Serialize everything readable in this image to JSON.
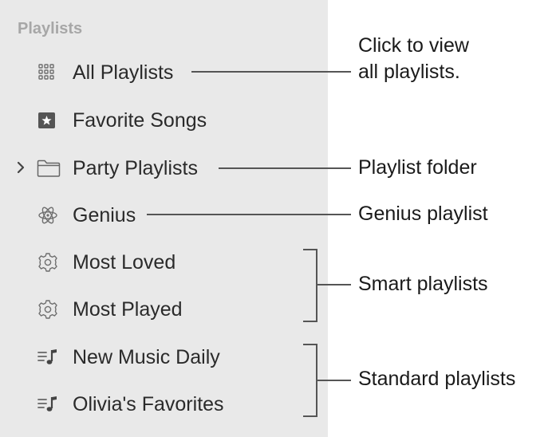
{
  "sidebar": {
    "section_title": "Playlists",
    "items": [
      {
        "label": "All Playlists",
        "icon": "grid-icon"
      },
      {
        "label": "Favorite Songs",
        "icon": "star-icon"
      },
      {
        "label": "Party Playlists",
        "icon": "folder-icon",
        "expandable": true
      },
      {
        "label": "Genius",
        "icon": "atom-icon"
      },
      {
        "label": "Most Loved",
        "icon": "gear-icon"
      },
      {
        "label": "Most Played",
        "icon": "gear-icon"
      },
      {
        "label": "New Music Daily",
        "icon": "playlist-icon"
      },
      {
        "label": "Olivia's Favorites",
        "icon": "playlist-icon"
      }
    ]
  },
  "callouts": {
    "all_playlists": "Click to view\nall playlists.",
    "folder": "Playlist folder",
    "genius": "Genius playlist",
    "smart": "Smart playlists",
    "standard": "Standard playlists"
  },
  "colors": {
    "sidebar_bg": "#e9e9e9",
    "section_header": "#a7a7a7",
    "icon": "#6e6e6e",
    "leader_line": "#555555"
  }
}
